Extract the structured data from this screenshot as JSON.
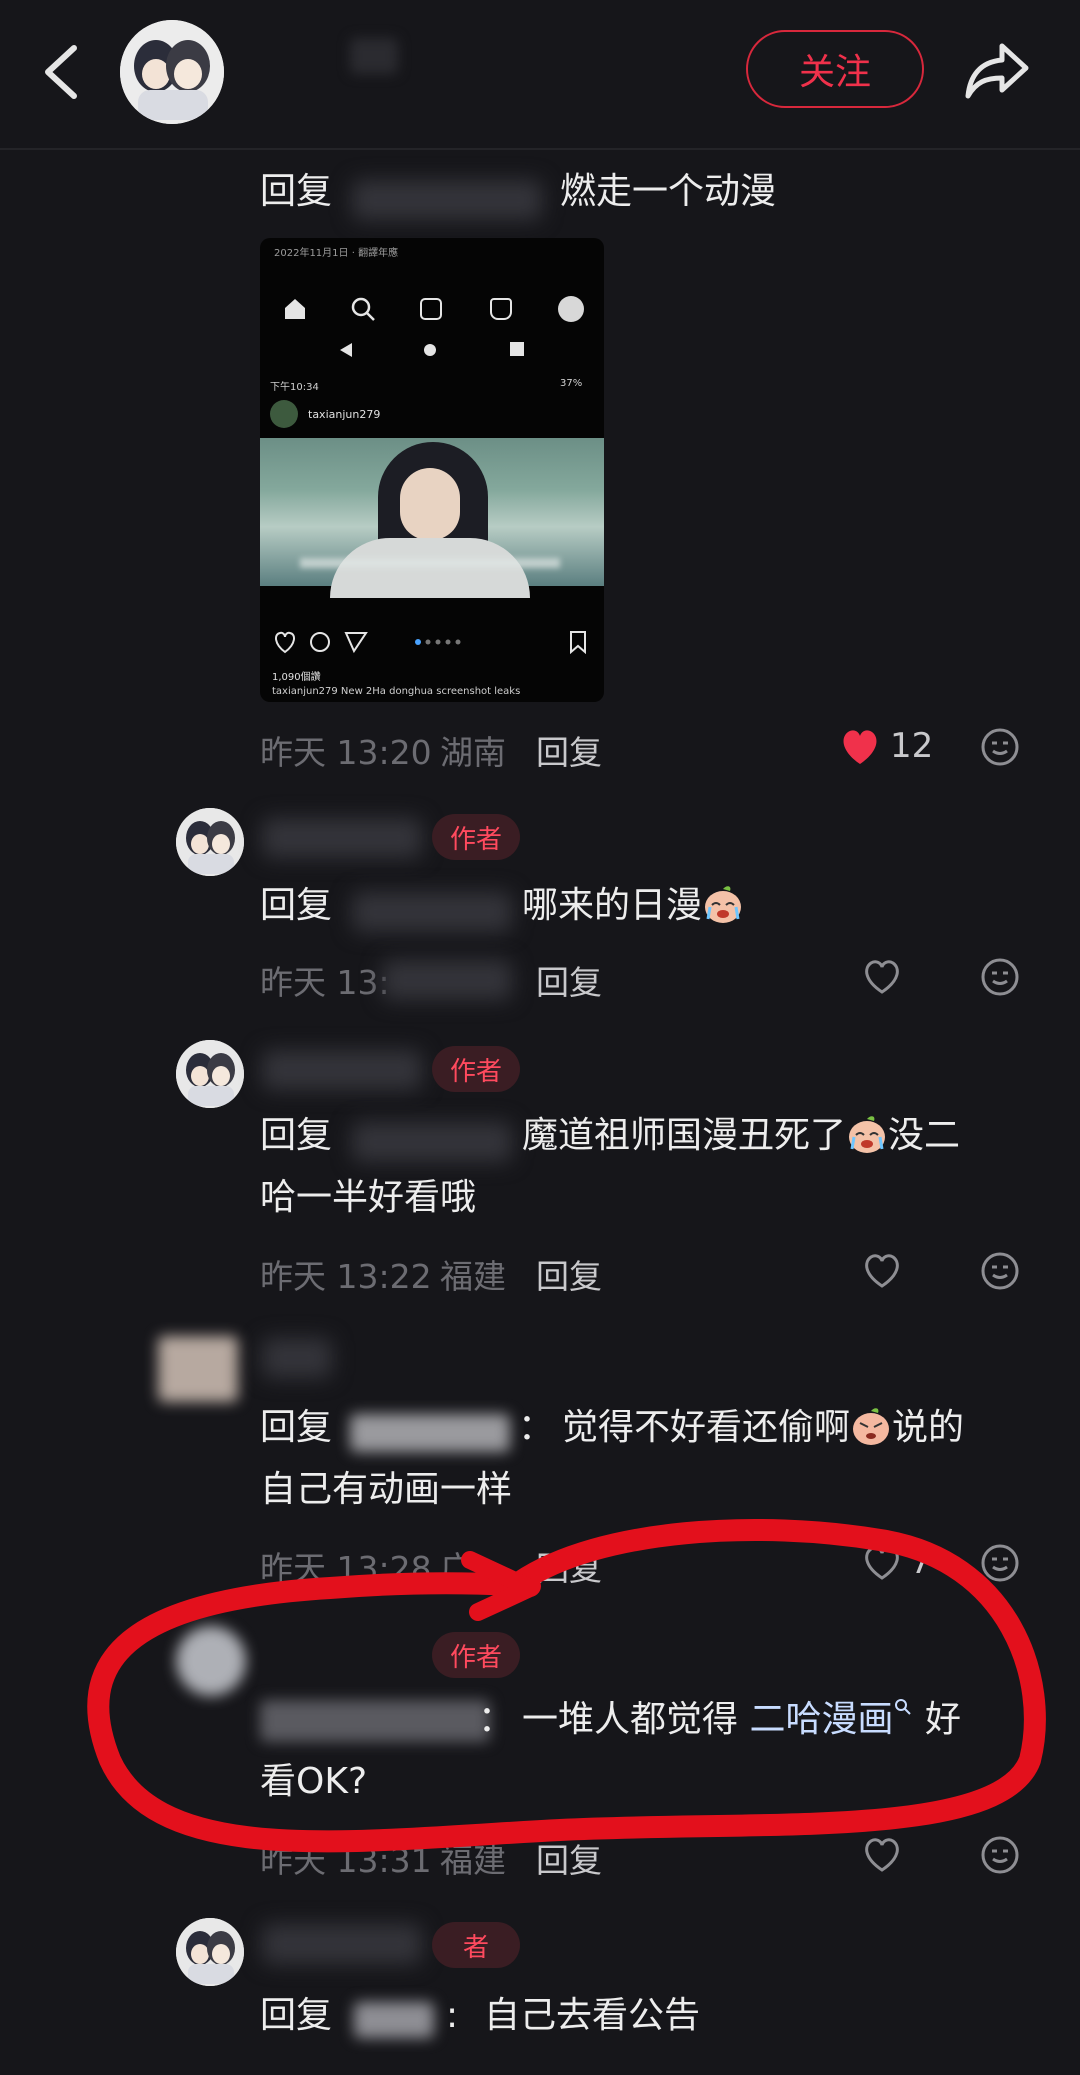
{
  "header": {
    "follow_label": "关注"
  },
  "comments": [
    {
      "reply_prefix": "回复",
      "text": "燃走一个动漫",
      "time": "昨天 13:20",
      "location": "湖南",
      "reply_label": "回复",
      "likes": "12",
      "liked": true,
      "image": {
        "date_caption": "2022年11月1日 · 翻譯年應",
        "status_time": "下午10:34",
        "status_right": "37%",
        "username": "taxianjun279",
        "like_count": "1,090個讚",
        "caption": "taxianjun279 New 2Ha donghua screenshot leaks"
      }
    },
    {
      "author_badge": "作者",
      "reply_prefix": "回复",
      "text": "哪来的日漫",
      "time": "昨天 13:",
      "reply_label": "回复"
    },
    {
      "author_badge": "作者",
      "reply_prefix": "回复",
      "text_line1": "魔道祖师国漫丑死了",
      "text_line1_end": "没二",
      "text_line2": "哈一半好看哦",
      "time": "昨天 13:22",
      "location": "福建",
      "reply_label": "回复"
    },
    {
      "reply_prefix": "回复",
      "colon": "：",
      "text_line1": "觉得不好看还偷啊",
      "text_line1_end": "说的",
      "text_line2": "自己有动画一样",
      "time": "昨天 13:28",
      "location": "广",
      "reply_label": "回复",
      "likes": "7"
    },
    {
      "author_badge": "作者",
      "colon": "：",
      "text_line1": "一堆人都觉得",
      "link_text": "二哈漫画",
      "text_line1_end": "好",
      "text_line2": "看OK?",
      "time": "昨天 13:31",
      "location": "福建",
      "reply_label": "回复"
    },
    {
      "author_badge": "者",
      "reply_prefix": "回复",
      "colon": ":",
      "text": "自己去看公告"
    }
  ],
  "colors": {
    "background": "#16161a",
    "accent_red": "#f0314b",
    "annotation_red": "#e3101c",
    "link_blue": "#c8dcff"
  },
  "icons": [
    "back-arrow-icon",
    "share-icon",
    "heart-icon",
    "emoji-icon",
    "search-icon"
  ]
}
